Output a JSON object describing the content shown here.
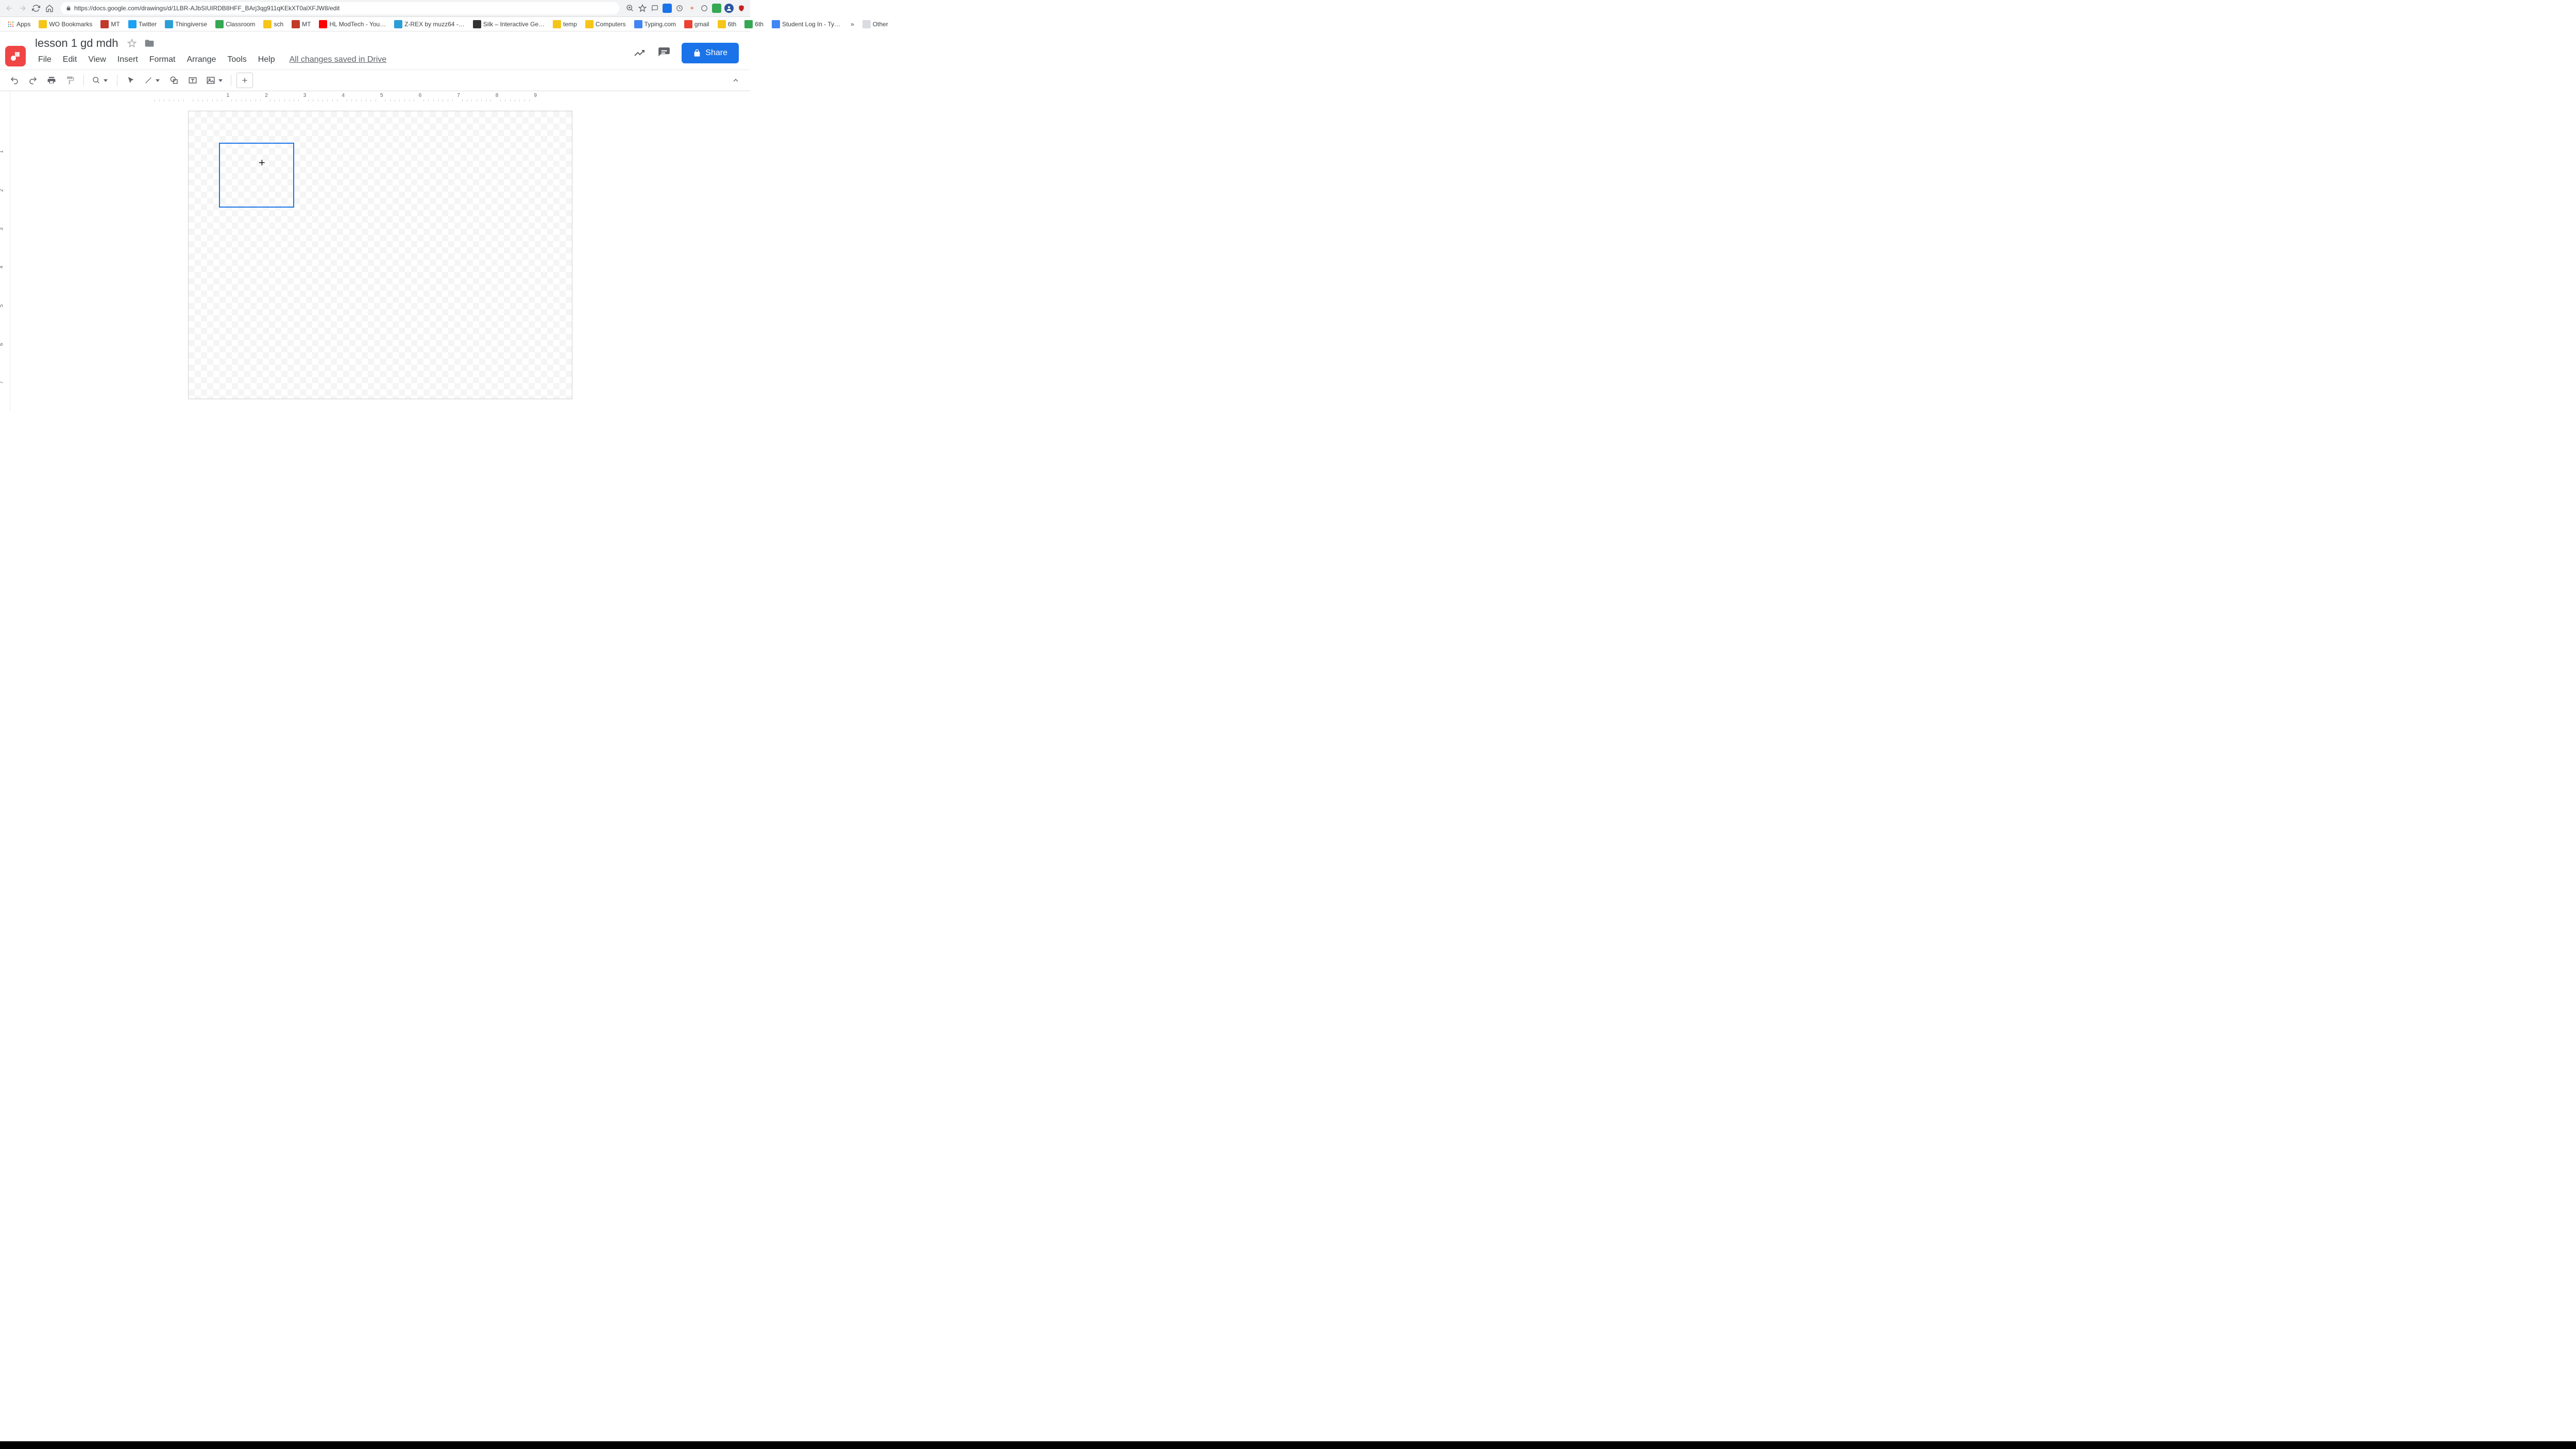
{
  "browser": {
    "url": "https://docs.google.com/drawings/d/1LBR-AJbSIUIRDB8HFF_BArj3qg911qKEkXT0alXFJW8/edit",
    "ext_more": "»",
    "other_label": "Other"
  },
  "bookmarks": [
    {
      "label": "Apps",
      "color": "#666"
    },
    {
      "label": "WO Bookmarks",
      "color": "#f5c518"
    },
    {
      "label": "MT",
      "color": "#c0392b"
    },
    {
      "label": "Twitter",
      "color": "#1da1f2"
    },
    {
      "label": "Thingiverse",
      "color": "#2a9fd6"
    },
    {
      "label": "Classroom",
      "color": "#34a853"
    },
    {
      "label": "sch",
      "color": "#f5c518"
    },
    {
      "label": "MT",
      "color": "#c0392b"
    },
    {
      "label": "HL ModTech - You…",
      "color": "#ff0000"
    },
    {
      "label": "Z-REX by muzz64 -…",
      "color": "#2a9fd6"
    },
    {
      "label": "Silk – Interactive Ge…",
      "color": "#333"
    },
    {
      "label": "temp",
      "color": "#f5c518"
    },
    {
      "label": "Computers",
      "color": "#f5c518"
    },
    {
      "label": "Typing.com",
      "color": "#4285f4"
    },
    {
      "label": "gmail",
      "color": "#ea4335"
    },
    {
      "label": "6th",
      "color": "#f5c518"
    },
    {
      "label": "6th",
      "color": "#34a853"
    },
    {
      "label": "Student Log In - Ty…",
      "color": "#4285f4"
    }
  ],
  "doc": {
    "title": "lesson 1 gd mdh",
    "saved_status": "All changes saved in Drive"
  },
  "menus": [
    "File",
    "Edit",
    "View",
    "Insert",
    "Format",
    "Arrange",
    "Tools",
    "Help"
  ],
  "share": {
    "label": "Share"
  },
  "ruler_h": [
    "1",
    "2",
    "3",
    "4",
    "5",
    "6",
    "7",
    "8",
    "9"
  ],
  "ruler_v": [
    "1",
    "2",
    "3",
    "4",
    "5",
    "6",
    "7"
  ]
}
